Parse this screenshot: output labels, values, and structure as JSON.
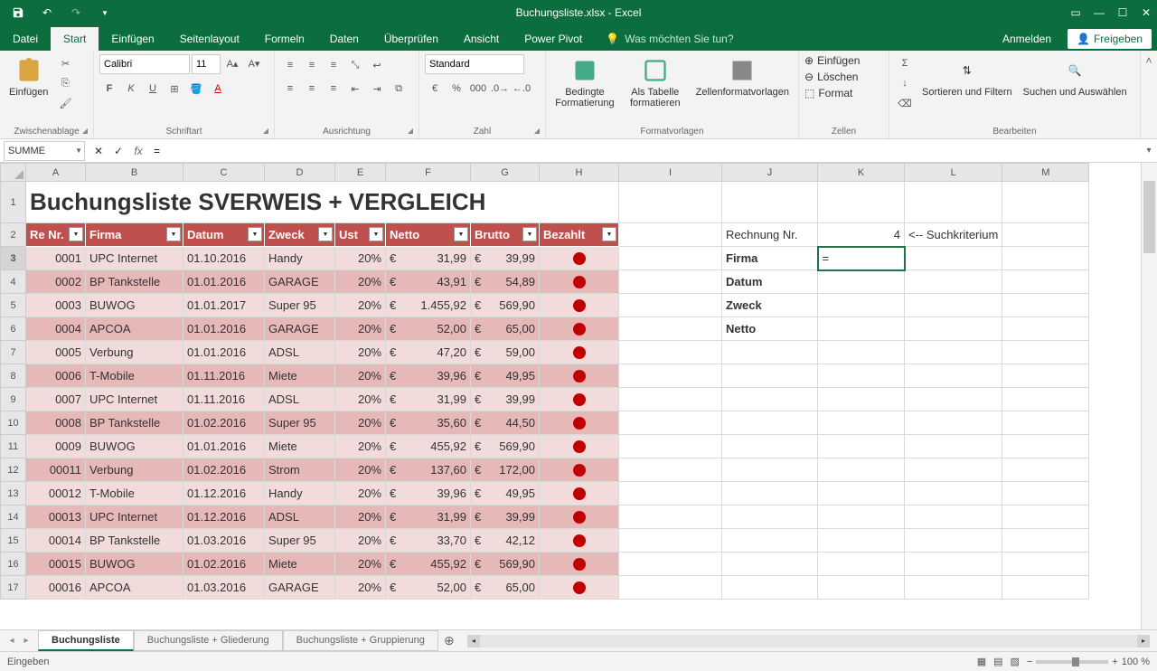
{
  "app": {
    "title": "Buchungsliste.xlsx - Excel"
  },
  "tabs": {
    "file": "Datei",
    "home": "Start",
    "insert": "Einfügen",
    "pagelayout": "Seitenlayout",
    "formulas": "Formeln",
    "data": "Daten",
    "review": "Überprüfen",
    "view": "Ansicht",
    "powerpivot": "Power Pivot",
    "tellme": "Was möchten Sie tun?",
    "signin": "Anmelden",
    "share": "Freigeben"
  },
  "ribbon": {
    "clipboard": {
      "label": "Zwischenablage",
      "paste": "Einfügen"
    },
    "font": {
      "label": "Schriftart",
      "name": "Calibri",
      "size": "11"
    },
    "align": {
      "label": "Ausrichtung"
    },
    "number": {
      "label": "Zahl",
      "format": "Standard"
    },
    "styles": {
      "label": "Formatvorlagen",
      "condfmt": "Bedingte Formatierung",
      "astable": "Als Tabelle formatieren",
      "cellstyles": "Zellenformatvorlagen"
    },
    "cells": {
      "label": "Zellen",
      "insert": "Einfügen",
      "delete": "Löschen",
      "format": "Format"
    },
    "editing": {
      "label": "Bearbeiten",
      "sortfilter": "Sortieren und Filtern",
      "findselect": "Suchen und Auswählen"
    }
  },
  "fbar": {
    "name": "SUMME",
    "formula": "="
  },
  "columns": [
    "A",
    "B",
    "C",
    "D",
    "E",
    "F",
    "G",
    "H",
    "I",
    "J",
    "K",
    "L",
    "M"
  ],
  "widths": [
    66,
    108,
    90,
    78,
    56,
    94,
    76,
    88,
    114,
    106,
    96,
    96,
    96
  ],
  "title_cell": "Buchungsliste SVERWEIS + VERGLEICH",
  "headers": [
    "Re Nr.",
    "Firma",
    "Datum",
    "Zweck",
    "Ust",
    "Netto",
    "Brutto",
    "Bezahlt"
  ],
  "rows": [
    {
      "n": "0001",
      "f": "UPC Internet",
      "d": "01.10.2016",
      "z": "Handy",
      "u": "20%",
      "ne": "31,99",
      "br": "39,99",
      "p": true
    },
    {
      "n": "0002",
      "f": "BP Tankstelle",
      "d": "01.01.2016",
      "z": "GARAGE",
      "u": "20%",
      "ne": "43,91",
      "br": "54,89",
      "p": true
    },
    {
      "n": "0003",
      "f": "BUWOG",
      "d": "01.01.2017",
      "z": "Super 95",
      "u": "20%",
      "ne": "1.455,92",
      "br": "569,90",
      "p": true
    },
    {
      "n": "0004",
      "f": "APCOA",
      "d": "01.01.2016",
      "z": "GARAGE",
      "u": "20%",
      "ne": "52,00",
      "br": "65,00",
      "p": true
    },
    {
      "n": "0005",
      "f": "Verbung",
      "d": "01.01.2016",
      "z": "ADSL",
      "u": "20%",
      "ne": "47,20",
      "br": "59,00",
      "p": true
    },
    {
      "n": "0006",
      "f": "T-Mobile",
      "d": "01.11.2016",
      "z": "Miete",
      "u": "20%",
      "ne": "39,96",
      "br": "49,95",
      "p": true
    },
    {
      "n": "0007",
      "f": "UPC Internet",
      "d": "01.11.2016",
      "z": "ADSL",
      "u": "20%",
      "ne": "31,99",
      "br": "39,99",
      "p": true
    },
    {
      "n": "0008",
      "f": "BP Tankstelle",
      "d": "01.02.2016",
      "z": "Super 95",
      "u": "20%",
      "ne": "35,60",
      "br": "44,50",
      "p": true
    },
    {
      "n": "0009",
      "f": "BUWOG",
      "d": "01.01.2016",
      "z": "Miete",
      "u": "20%",
      "ne": "455,92",
      "br": "569,90",
      "p": true
    },
    {
      "n": "00011",
      "f": "Verbung",
      "d": "01.02.2016",
      "z": "Strom",
      "u": "20%",
      "ne": "137,60",
      "br": "172,00",
      "p": true
    },
    {
      "n": "00012",
      "f": "T-Mobile",
      "d": "01.12.2016",
      "z": "Handy",
      "u": "20%",
      "ne": "39,96",
      "br": "49,95",
      "p": true
    },
    {
      "n": "00013",
      "f": "UPC Internet",
      "d": "01.12.2016",
      "z": "ADSL",
      "u": "20%",
      "ne": "31,99",
      "br": "39,99",
      "p": true
    },
    {
      "n": "00014",
      "f": "BP Tankstelle",
      "d": "01.03.2016",
      "z": "Super 95",
      "u": "20%",
      "ne": "33,70",
      "br": "42,12",
      "p": true
    },
    {
      "n": "00015",
      "f": "BUWOG",
      "d": "01.02.2016",
      "z": "Miete",
      "u": "20%",
      "ne": "455,92",
      "br": "569,90",
      "p": true
    },
    {
      "n": "00016",
      "f": "APCOA",
      "d": "01.03.2016",
      "z": "GARAGE",
      "u": "20%",
      "ne": "52,00",
      "br": "65,00",
      "p": true
    }
  ],
  "lookup": {
    "title": "Rechnung Nr.",
    "value": "4",
    "hint": "<-- Suchkriterium",
    "fields": [
      "Firma",
      "Datum",
      "Zweck",
      "Netto"
    ],
    "cellvalue": "="
  },
  "sheets": {
    "active": "Buchungsliste",
    "s2": "Buchungsliste + Gliederung",
    "s3": "Buchungsliste + Gruppierung"
  },
  "status": {
    "mode": "Eingeben",
    "zoom": "100 %"
  }
}
